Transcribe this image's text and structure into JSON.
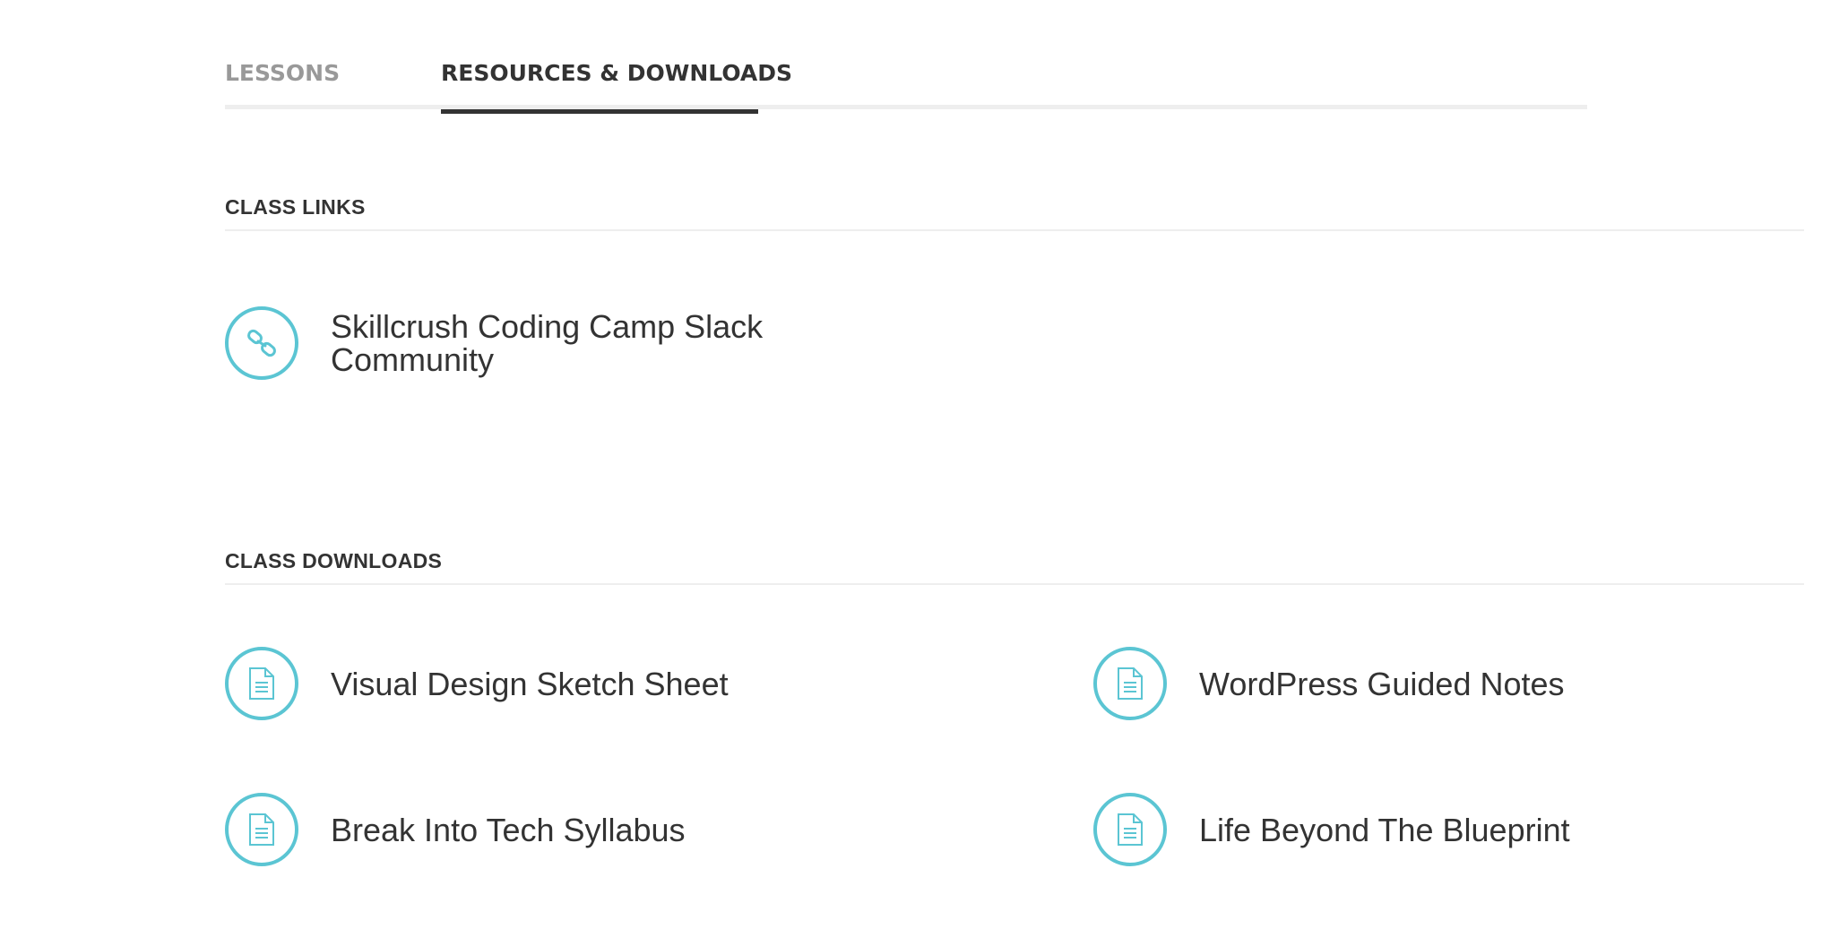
{
  "tabs": [
    {
      "label": "LESSONS",
      "active": false
    },
    {
      "label": "RESOURCES & DOWNLOADS",
      "active": true
    }
  ],
  "sections": {
    "links": {
      "heading": "CLASS LINKS",
      "items": [
        {
          "label": "Skillcrush Coding Camp Slack Community",
          "icon": "link-icon"
        }
      ]
    },
    "downloads": {
      "heading": "CLASS DOWNLOADS",
      "items": [
        {
          "label": "Visual Design Sketch Sheet",
          "icon": "document-icon"
        },
        {
          "label": "WordPress Guided Notes",
          "icon": "document-icon"
        },
        {
          "label": "Break Into Tech Syllabus",
          "icon": "document-icon"
        },
        {
          "label": "Life Beyond The Blueprint",
          "icon": "document-icon"
        }
      ]
    }
  },
  "colors": {
    "accent": "#5bc5d3",
    "text": "#333333",
    "tab_inactive": "#999999",
    "divider": "#eeeeee"
  }
}
